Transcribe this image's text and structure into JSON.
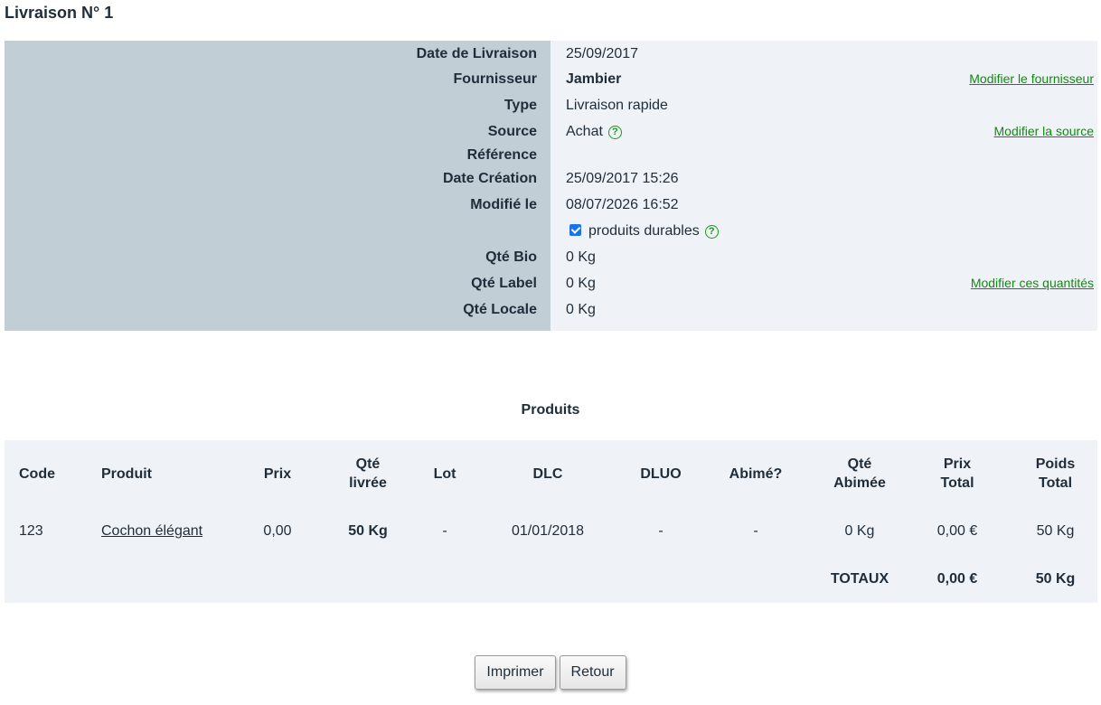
{
  "page": {
    "title": "Livraison N° 1"
  },
  "info": {
    "rows": [
      {
        "label": "Date de Livraison",
        "value": "25/09/2017"
      },
      {
        "label": "Fournisseur",
        "value": "Jambier",
        "action": "Modifier le fournisseur"
      },
      {
        "label": "Type",
        "value": "Livraison rapide"
      },
      {
        "label": "Source",
        "value": "Achat",
        "action": "Modifier la source"
      },
      {
        "label": "Référence",
        "value": ""
      },
      {
        "label": "Date Création",
        "value": "25/09/2017 15:26"
      },
      {
        "label": "Modifié le",
        "value": "08/07/2026 16:52"
      },
      {
        "label": "",
        "value": "produits durables",
        "checked": true
      },
      {
        "label": "Qté Bio",
        "value": "0 Kg"
      },
      {
        "label": "Qté Label",
        "value": "0 Kg",
        "action": "Modifier ces quantités"
      },
      {
        "label": "Qté Locale",
        "value": "0 Kg"
      }
    ],
    "help_glyph": "?"
  },
  "products": {
    "title": "Produits",
    "headers": {
      "code": "Code",
      "produit": "Produit",
      "prix": "Prix",
      "qte_livree_1": "Qté",
      "qte_livree_2": "livrée",
      "lot": "Lot",
      "dlc": "DLC",
      "dluo": "DLUO",
      "abime": "Abimé?",
      "qte_abimee_1": "Qté",
      "qte_abimee_2": "Abimée",
      "prix_total_1": "Prix",
      "prix_total_2": "Total",
      "poids_total_1": "Poids",
      "poids_total_2": "Total"
    },
    "rows": [
      {
        "code": "123",
        "produit": "Cochon élégant",
        "prix": "0,00",
        "qte_livree": "50 Kg",
        "lot": "-",
        "dlc": "01/01/2018",
        "dluo": "-",
        "abime": "-",
        "qte_abimee": "0 Kg",
        "prix_total": "0,00 €",
        "poids_total": "50 Kg"
      }
    ],
    "totals": {
      "label": "TOTAUX",
      "prix_total": "0,00 €",
      "poids_total": "50 Kg"
    }
  },
  "buttons": {
    "print": "Imprimer",
    "back": "Retour"
  },
  "colors": {
    "label_bg": "#c2ced6",
    "panel_bg": "#eff2f6",
    "link": "#118a11",
    "checkbox": "#1a73e8"
  }
}
